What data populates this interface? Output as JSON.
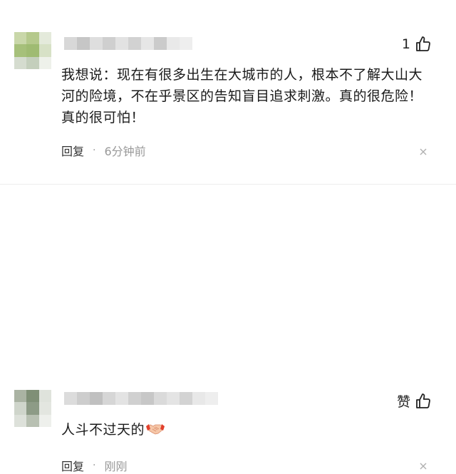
{
  "comments": [
    {
      "like_label": "1",
      "text": "我想说：现在有很多出生在大城市的人，根本不了解大山大河的险境，不在乎景区的告知盲目追求刺激。真的很危险！真的很可怕！",
      "reply_label": "回复",
      "separator": "·",
      "time": "6分钟前"
    },
    {
      "like_label": "赞",
      "text": "人斗不过天的",
      "reply_label": "回复",
      "separator": "·",
      "time": "刚刚"
    }
  ],
  "icons": {
    "like": "thumbs-up-icon",
    "close": "close-icon",
    "emoji": "handshake-emoji"
  }
}
